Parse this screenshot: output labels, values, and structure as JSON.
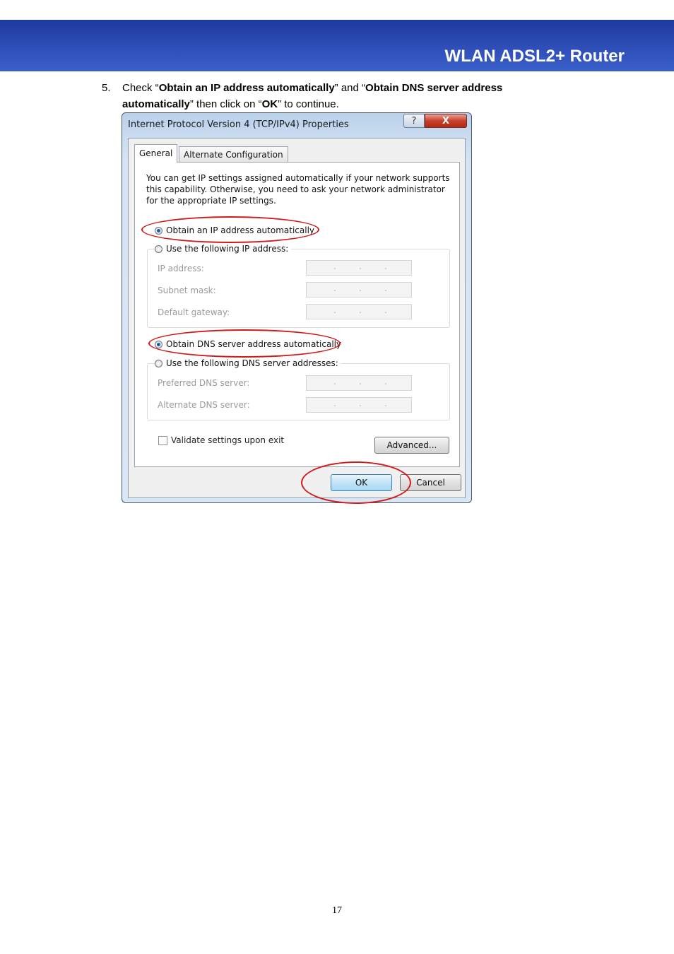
{
  "header": {
    "title": "WLAN ADSL2+ Router"
  },
  "step": {
    "number": "5.",
    "t1": "Check “",
    "b1": "Obtain an IP address automatically",
    "t2": "” and “",
    "b2": "Obtain DNS server address automatically",
    "t3": "” then click on “",
    "b3": "OK",
    "t4": "” to continue."
  },
  "dialog": {
    "title": "Internet Protocol Version 4 (TCP/IPv4) Properties",
    "help": "?",
    "close": "X",
    "tabs": {
      "general": "General",
      "alternate": "Alternate Configuration"
    },
    "description": "You can get IP settings assigned automatically if your network supports this capability. Otherwise, you need to ask your network administrator for the appropriate IP settings.",
    "radio_auto_ip": "Obtain an IP address automatically",
    "radio_static_ip": "Use the following IP address:",
    "ip_address_label": "IP address:",
    "subnet_mask_label": "Subnet mask:",
    "default_gateway_label": "Default gateway:",
    "radio_auto_dns": "Obtain DNS server address automatically",
    "radio_static_dns": "Use the following DNS server addresses:",
    "preferred_dns_label": "Preferred DNS server:",
    "alternate_dns_label": "Alternate DNS server:",
    "ip_dot": ".",
    "validate_label": "Validate settings upon exit",
    "advanced": "Advanced...",
    "ok": "OK",
    "cancel": "Cancel"
  },
  "colors": {
    "annotation": "#d11a1a",
    "header_band": "#2c4bb4"
  },
  "page_number": "17"
}
